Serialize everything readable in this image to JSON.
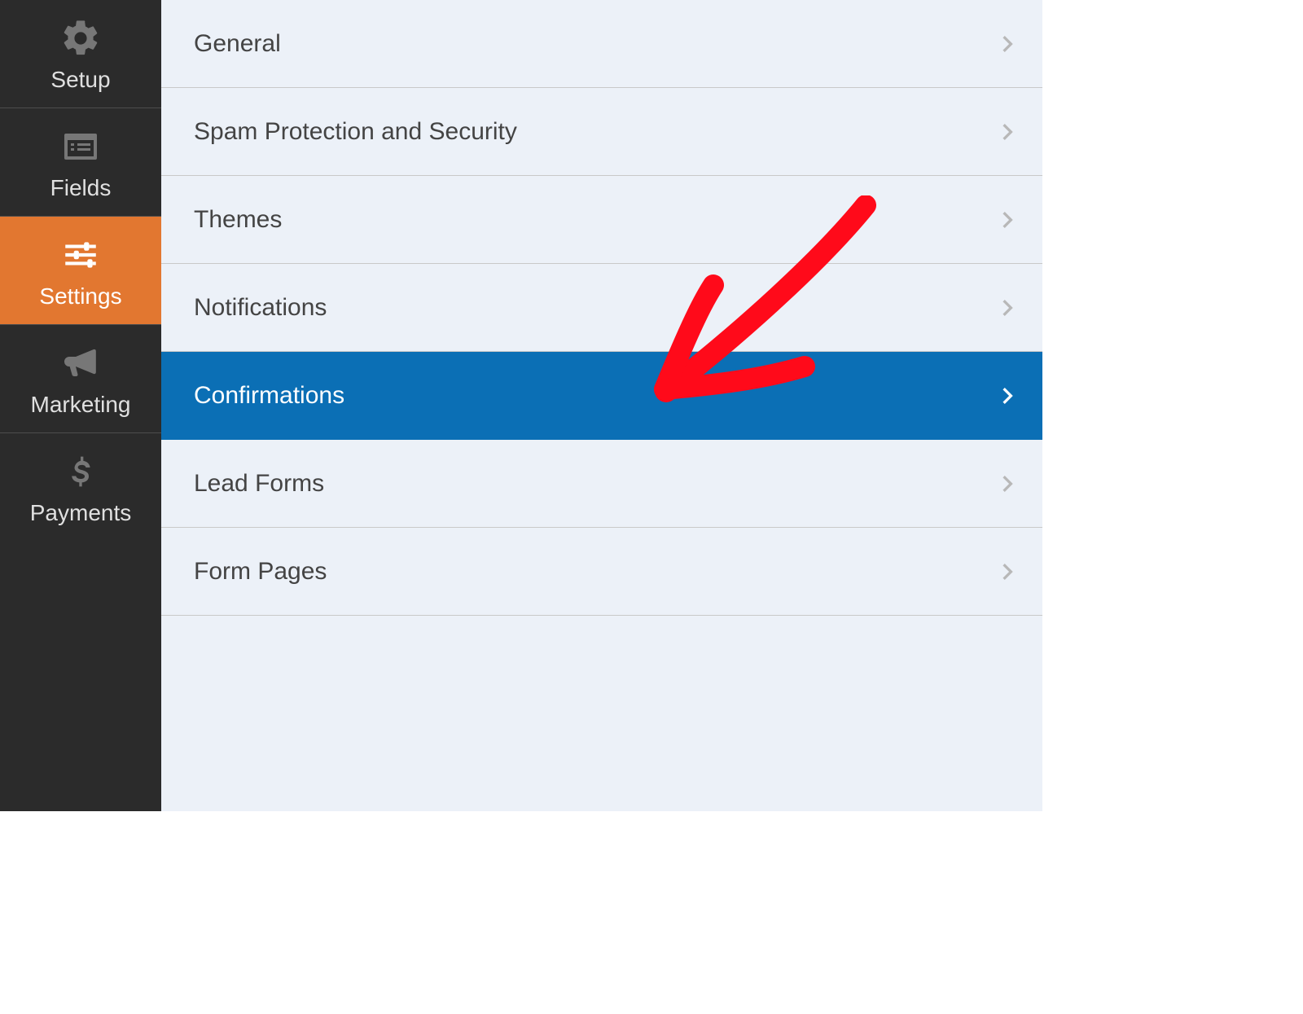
{
  "sidebar": {
    "items": [
      {
        "label": "Setup",
        "icon": "gear-icon",
        "active": false
      },
      {
        "label": "Fields",
        "icon": "list-icon",
        "active": false
      },
      {
        "label": "Settings",
        "icon": "sliders-icon",
        "active": true
      },
      {
        "label": "Marketing",
        "icon": "bullhorn-icon",
        "active": false
      },
      {
        "label": "Payments",
        "icon": "dollar-icon",
        "active": false
      }
    ]
  },
  "settings_list": {
    "items": [
      {
        "label": "General",
        "selected": false
      },
      {
        "label": "Spam Protection and Security",
        "selected": false
      },
      {
        "label": "Themes",
        "selected": false
      },
      {
        "label": "Notifications",
        "selected": false
      },
      {
        "label": "Confirmations",
        "selected": true
      },
      {
        "label": "Lead Forms",
        "selected": false
      },
      {
        "label": "Form Pages",
        "selected": false
      }
    ]
  },
  "annotation": {
    "type": "arrow",
    "color": "#ff0a1a",
    "points_to": "Confirmations"
  }
}
